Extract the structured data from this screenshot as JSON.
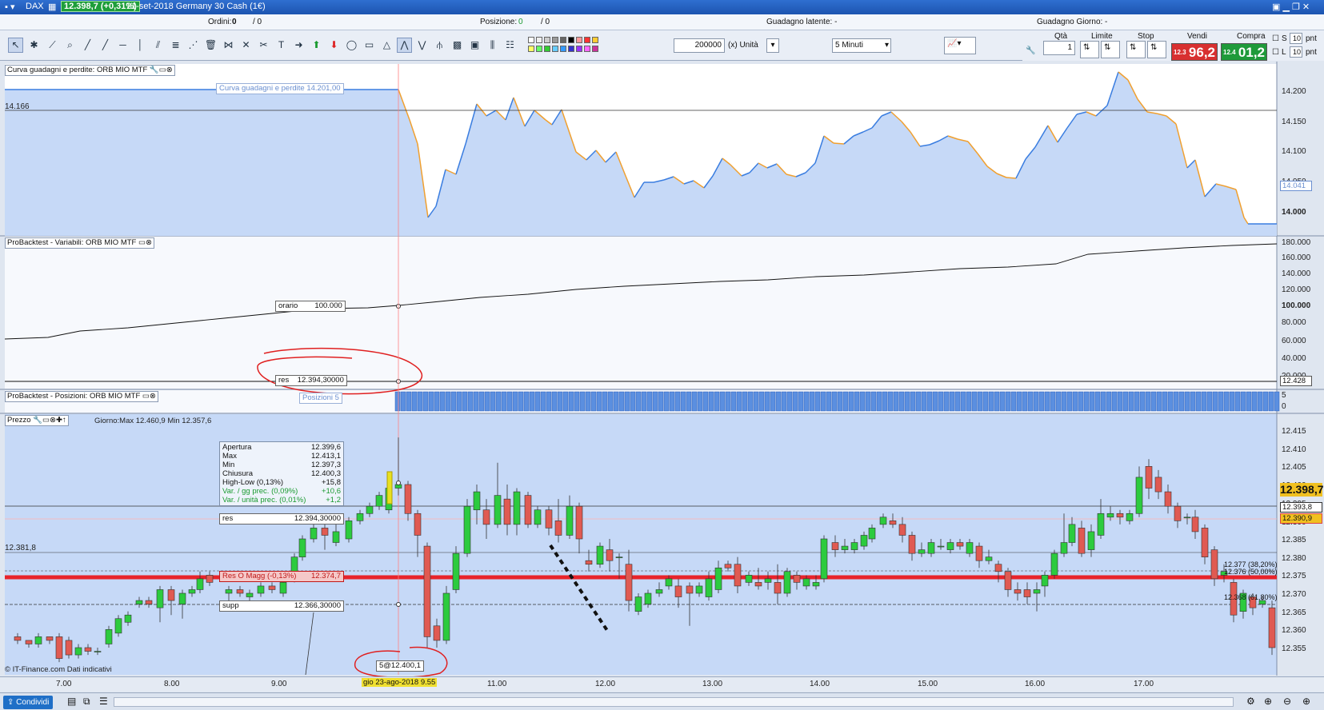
{
  "titlebar": {
    "instrument": "DAX",
    "price_badge": "12.398,7 (+0,31%)",
    "description": "21-set-2018 Germany 30 Cash (1€)"
  },
  "infobar": {
    "ordini_label": "Ordini:",
    "ordini_value": "0",
    "ordini_sep": "/ 0",
    "posizione_label": "Posizione:",
    "posizione_value": "0",
    "posizione_sep": "/ 0",
    "latente_label": "Guadagno latente: -",
    "giorno_label": "Guadagno Giorno: -"
  },
  "toolbar": {
    "quantity": "200000",
    "unit": "(x) Unità",
    "timeframe": "5 Minuti"
  },
  "order_panel": {
    "qty_label": "Qtà",
    "qty_value": "1",
    "limit_label": "Limite",
    "stop_label": "Stop",
    "sell_label": "Vendi",
    "sell_small": "12.3",
    "sell_big": "96,2",
    "buy_label": "Compra",
    "buy_small": "12.4",
    "buy_big": "01,2",
    "s_label": "S",
    "l_label": "L",
    "s_value": "10",
    "l_value": "10",
    "pnt": "pnt"
  },
  "colors": {
    "panel_bg": "#c6d9f7",
    "pnl_up": "#3a7de0",
    "pnl_down": "#f0a030",
    "bull": "#2ccb3e",
    "bear": "#e05a52",
    "res_line": "#e8232a"
  },
  "panels": {
    "pnl": {
      "header": "Curva guadagni e perdite: ORB MIO MTF",
      "tag": "Curva guadagni e perdite   14.201,00",
      "left_label": "14.166",
      "axis": [
        "14.200",
        "14.150",
        "14.100",
        "14.050",
        "14.000"
      ],
      "marker": "14.041"
    },
    "variables": {
      "header": "ProBacktest - Variabili: ORB MIO MTF",
      "orario_label": "orario",
      "orario_value": "100.000",
      "res_label": "res",
      "res_value": "12.394,30000",
      "axis": [
        "180.000",
        "160.000",
        "140.000",
        "120.000",
        "100.000",
        "80.000",
        "60.000",
        "40.000",
        "20.000"
      ],
      "marker": "12.428"
    },
    "positions": {
      "header": "ProBacktest - Posizioni: ORB MIO MTF",
      "tag": "Posizioni   5",
      "axis_top": "5",
      "axis_bottom": "0"
    },
    "price": {
      "header": "Prezzo",
      "day_info": "Giorno:Max 12.460,9 Min 12.357,6",
      "left_label": "12.381,8",
      "axis": [
        "12.415",
        "12.410",
        "12.405",
        "12.400",
        "12.395",
        "12.390",
        "12.385",
        "12.380",
        "12.375",
        "12.370",
        "12.365",
        "12.360",
        "12.355"
      ],
      "badge_last": "12.398,7",
      "badge_1": "12.393,8",
      "badge_2": "12.390,9",
      "fib1": "12.377 (38,20%)",
      "fib2": "12.376 (50,00%)",
      "fib3": "12.368 (61,80%)",
      "res_tag_label": "res",
      "res_tag_value": "12.394,30000",
      "resmagg_label": "Res O Magg (-0,13%)",
      "resmagg_value": "12.374,7",
      "supp_label": "supp",
      "supp_value": "12.366,30000",
      "order_marker": "5@12.400,1",
      "watermark": "© IT-Finance.com  Dati indicativi",
      "tooltip": [
        [
          "Apertura",
          "12.399,6"
        ],
        [
          "Max",
          "12.413,1"
        ],
        [
          "Min",
          "12.397,3"
        ],
        [
          "Chiusura",
          "12.400,3"
        ],
        [
          "High-Low (0,13%)",
          "+15,8"
        ],
        [
          "Var. / gg prec. (0,09%)",
          "+10,6"
        ],
        [
          "Var. / unità prec. (0,01%)",
          "+1,2"
        ]
      ]
    }
  },
  "time_axis": [
    "7.00",
    "8.00",
    "9.00",
    "11.00",
    "12.00",
    "13.00",
    "14.00",
    "15.00",
    "16.00",
    "17.00"
  ],
  "cursor_date": "gio 23-ago-2018 9.55",
  "statusbar": {
    "share": "Condividi"
  }
}
